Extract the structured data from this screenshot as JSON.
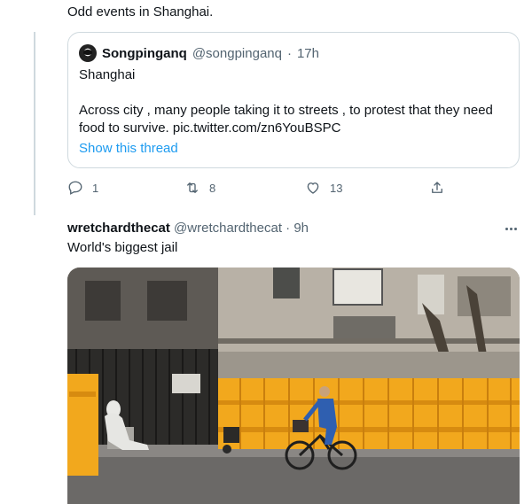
{
  "top_tweet": {
    "text": "Odd events in Shanghai."
  },
  "quoted_tweet": {
    "name": "Songpinganq",
    "handle": "@songpinganq",
    "separator": "·",
    "time": "17h",
    "lines": [
      "Shanghai",
      "",
      "Across city , many people taking it to streets , to protest that they need",
      "food to survive. pic.twitter.com/zn6YouBSPC"
    ],
    "show_thread": "Show this thread"
  },
  "actions": {
    "reply_count": "1",
    "retweet_count": "8",
    "like_count": "13"
  },
  "second_tweet": {
    "name": "wretchardthecat",
    "handle": "@wretchardthecat",
    "separator": "·",
    "time": "9h",
    "text": "World's biggest jail",
    "photo_icon": "street-photo"
  },
  "colors": {
    "accent": "#1d9bf0",
    "muted": "#536471",
    "border": "#cfd9de",
    "barrier": "#f2a81d"
  }
}
